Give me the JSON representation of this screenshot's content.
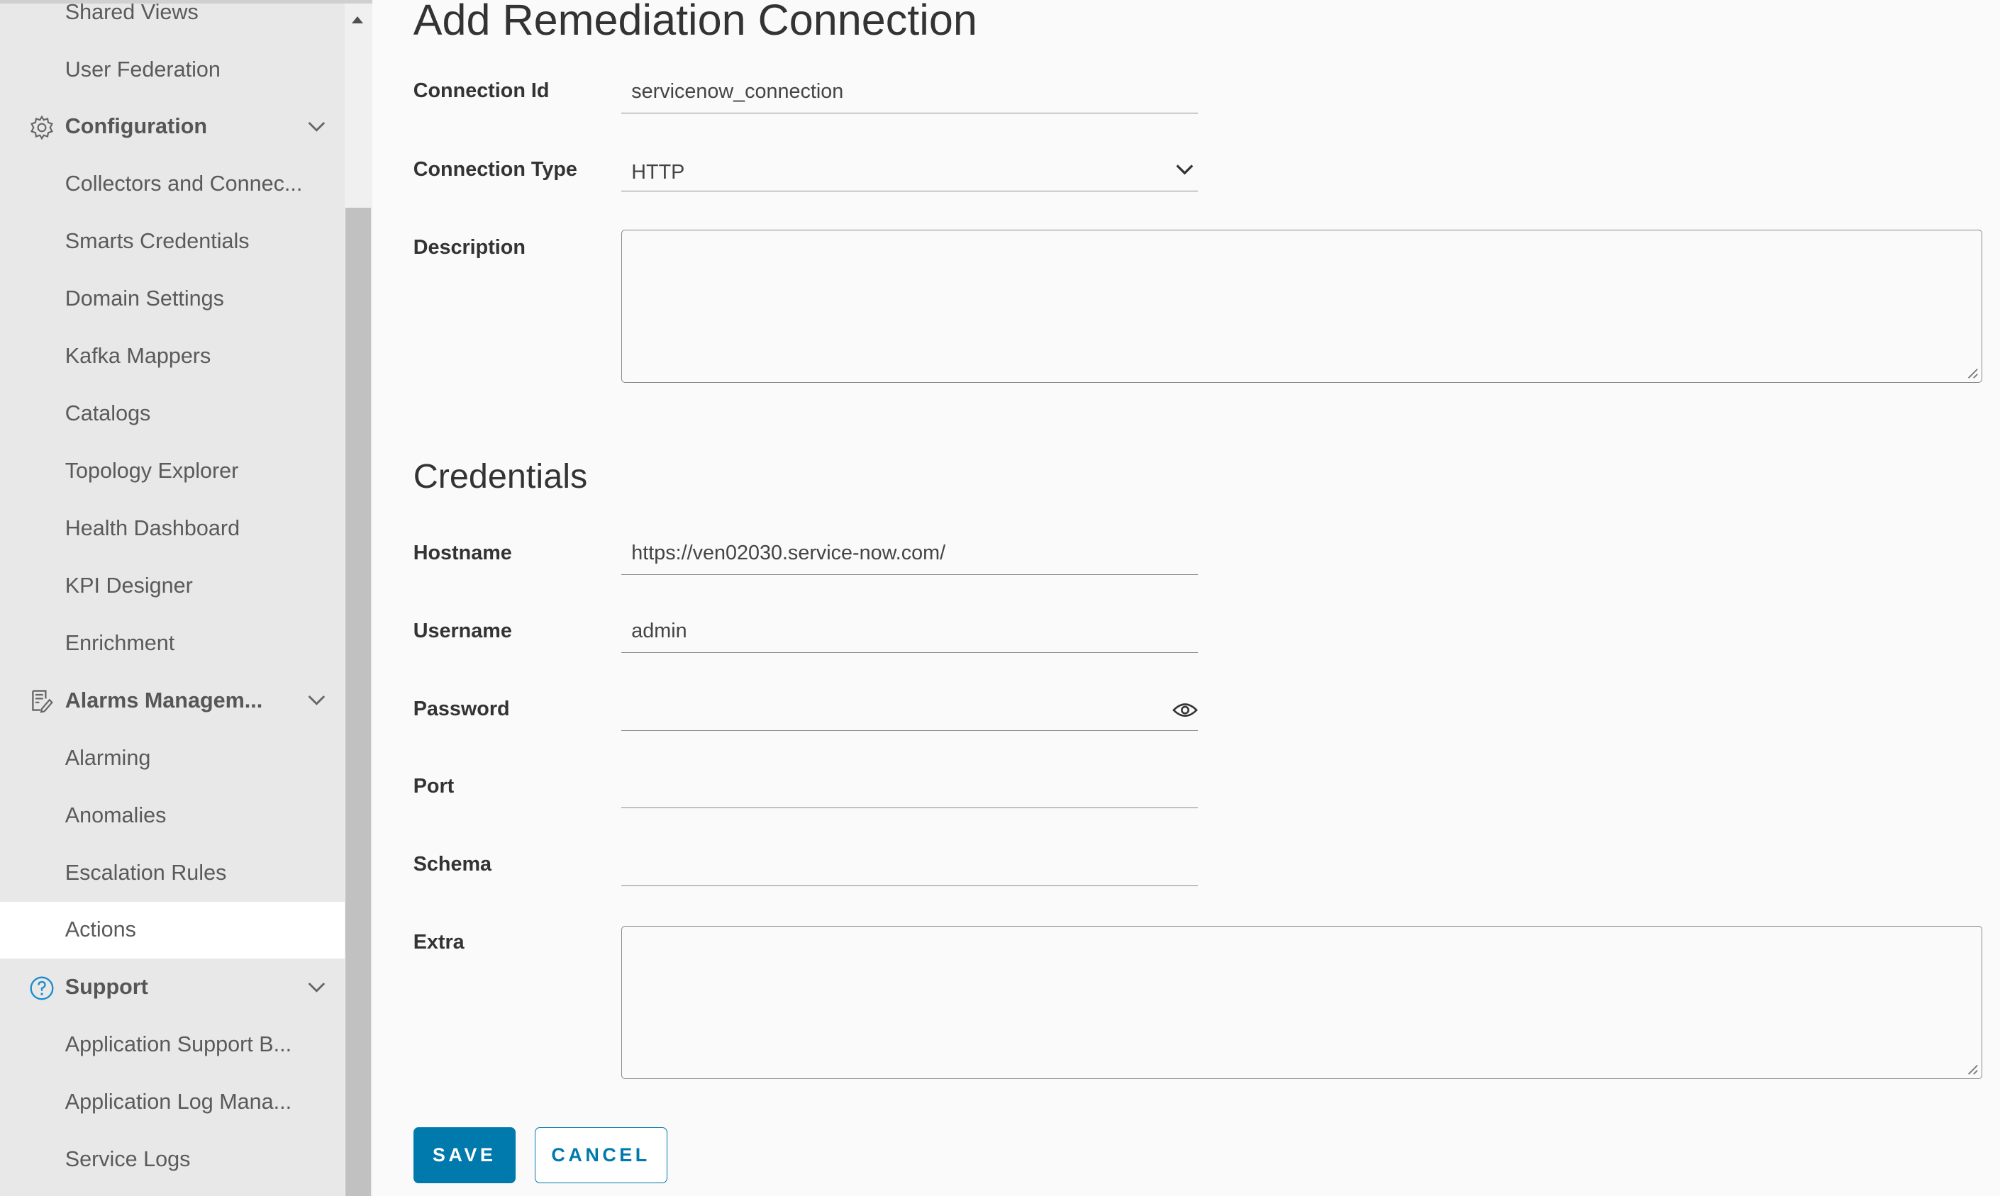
{
  "sidebar": {
    "items": [
      {
        "label": "Shared Views",
        "type": "item"
      },
      {
        "label": "User Federation",
        "type": "item"
      },
      {
        "label": "Configuration",
        "type": "group",
        "icon": "gear-icon"
      },
      {
        "label": "Collectors and Connec...",
        "type": "item"
      },
      {
        "label": "Smarts Credentials",
        "type": "item"
      },
      {
        "label": "Domain Settings",
        "type": "item"
      },
      {
        "label": "Kafka Mappers",
        "type": "item"
      },
      {
        "label": "Catalogs",
        "type": "item"
      },
      {
        "label": "Topology Explorer",
        "type": "item"
      },
      {
        "label": "Health Dashboard",
        "type": "item"
      },
      {
        "label": "KPI Designer",
        "type": "item"
      },
      {
        "label": "Enrichment",
        "type": "item"
      },
      {
        "label": "Alarms Managem...",
        "type": "group",
        "icon": "note-edit-icon"
      },
      {
        "label": "Alarming",
        "type": "item"
      },
      {
        "label": "Anomalies",
        "type": "item"
      },
      {
        "label": "Escalation Rules",
        "type": "item"
      },
      {
        "label": "Actions",
        "type": "item",
        "active": true
      },
      {
        "label": "Support",
        "type": "group",
        "icon": "help-circle-icon"
      },
      {
        "label": "Application Support B...",
        "type": "item"
      },
      {
        "label": "Application Log Mana...",
        "type": "item"
      },
      {
        "label": "Service Logs",
        "type": "item"
      }
    ]
  },
  "form": {
    "title": "Add Remediation Connection",
    "connection_id": {
      "label": "Connection Id",
      "value": "servicenow_connection"
    },
    "connection_type": {
      "label": "Connection Type",
      "value": "HTTP"
    },
    "description": {
      "label": "Description",
      "value": ""
    },
    "credentials_title": "Credentials",
    "hostname": {
      "label": "Hostname",
      "value": "https://ven02030.service-now.com/"
    },
    "username": {
      "label": "Username",
      "value": "admin"
    },
    "password": {
      "label": "Password",
      "value": ""
    },
    "port": {
      "label": "Port",
      "value": ""
    },
    "schema": {
      "label": "Schema",
      "value": ""
    },
    "extra": {
      "label": "Extra",
      "value": ""
    },
    "save_label": "SAVE",
    "cancel_label": "CANCEL"
  },
  "colors": {
    "accent": "#0079ad",
    "sidebar_bg": "#e8e8e8",
    "active_item_bg": "#ffffff",
    "help_icon": "#1a8ccc"
  }
}
